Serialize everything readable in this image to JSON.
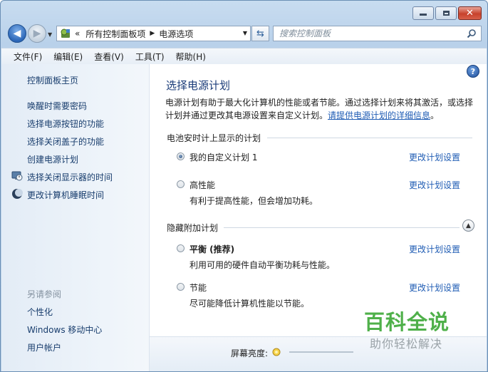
{
  "window": {
    "minimize_label": "minimize",
    "maximize_label": "maximize",
    "close_label": "close"
  },
  "address": {
    "chevrons": "«",
    "segments": [
      "所有控制面板项",
      "电源选项"
    ]
  },
  "search": {
    "placeholder": "搜索控制面板"
  },
  "menu": [
    {
      "label": "文件(F)"
    },
    {
      "label": "编辑(E)"
    },
    {
      "label": "查看(V)"
    },
    {
      "label": "工具(T)"
    },
    {
      "label": "帮助(H)"
    }
  ],
  "sidebar": {
    "home": "控制面板主页",
    "links": [
      {
        "label": "唤醒时需要密码",
        "icon": ""
      },
      {
        "label": "选择电源按钮的功能",
        "icon": ""
      },
      {
        "label": "选择关闭盖子的功能",
        "icon": ""
      },
      {
        "label": "创建电源计划",
        "icon": ""
      },
      {
        "label": "选择关闭显示器的时间",
        "icon": "display-timer-icon"
      },
      {
        "label": "更改计算机睡眠时间",
        "icon": "sleep-moon-icon"
      }
    ],
    "see_also_heading": "另请参阅",
    "see_also": [
      {
        "label": "个性化"
      },
      {
        "label": "Windows 移动中心"
      },
      {
        "label": "用户帐户"
      }
    ]
  },
  "main": {
    "title": "选择电源计划",
    "description": "电源计划有助于最大化计算机的性能或者节能。通过选择计划来将其激活，或选择计划并通过更改其电源设置来自定义计划。",
    "description_link": "请提供电源计划的详细信息",
    "description_end": "。",
    "battery_group_title": "电池安时计上显示的计划",
    "hidden_group_title": "隐藏附加计划",
    "change_label": "更改计划设置",
    "plans_visible": [
      {
        "name": "我的自定义计划 1",
        "desc": "",
        "checked": true
      },
      {
        "name": "高性能",
        "desc": "有利于提高性能，但会增加功耗。",
        "checked": false
      }
    ],
    "plans_hidden": [
      {
        "name": "平衡 (推荐)",
        "desc": "利用可用的硬件自动平衡功耗与性能。",
        "checked": false
      },
      {
        "name": "节能",
        "desc": "尽可能降低计算机性能以节能。",
        "checked": false
      }
    ],
    "brightness_label": "屏幕亮度:"
  },
  "watermark": {
    "title": "百科全说",
    "subtitle": "助你轻松解决"
  },
  "colors": {
    "link": "#1f5cb4",
    "title": "#1a3b78",
    "watermark_green": "#4fb04a"
  }
}
